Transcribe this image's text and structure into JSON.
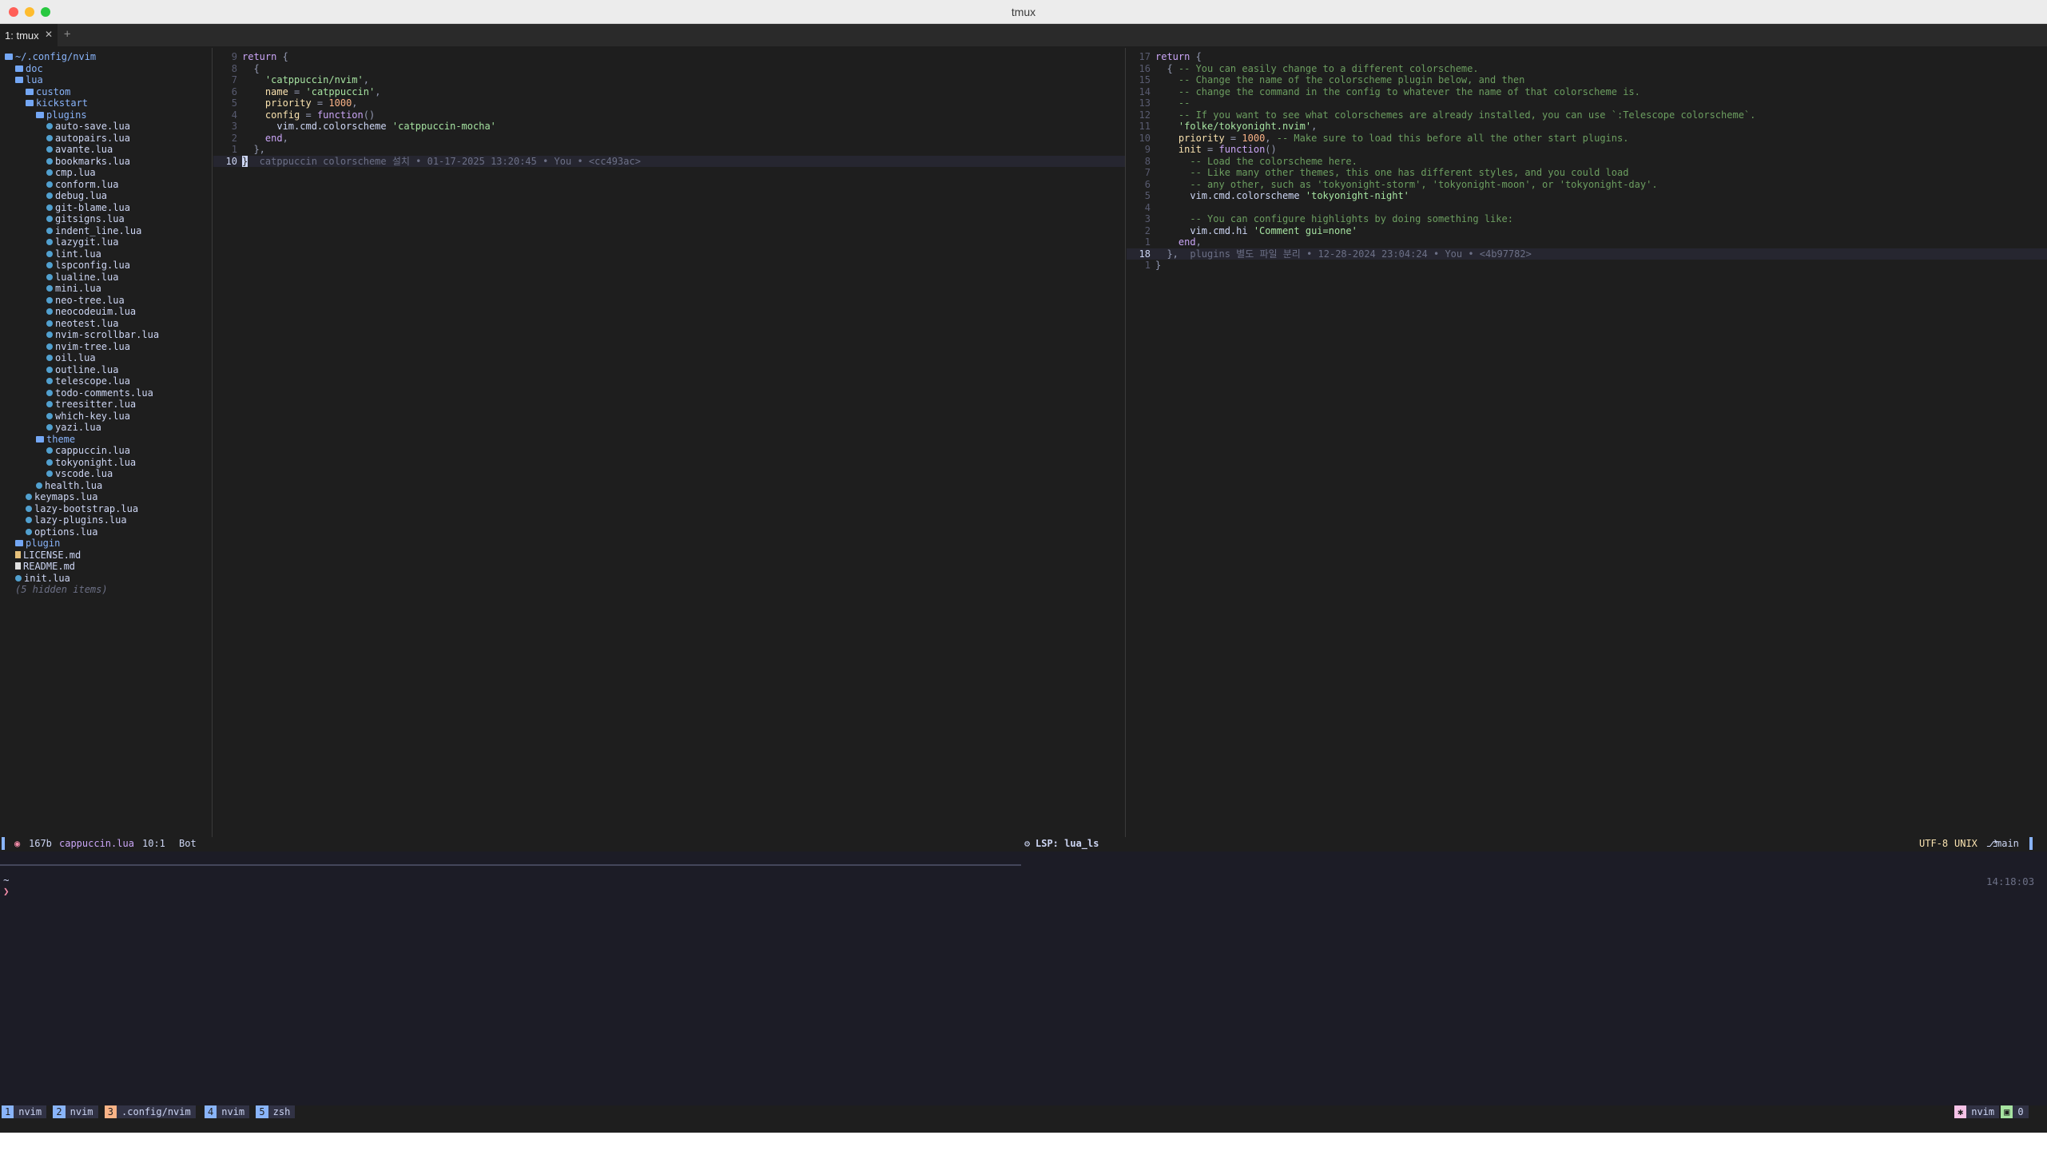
{
  "window": {
    "title": "tmux"
  },
  "tab": {
    "label": "1: tmux",
    "close": "✕",
    "new": "+"
  },
  "tree": [
    {
      "depth": 0,
      "type": "dir",
      "name": "~/.config/nvim"
    },
    {
      "depth": 1,
      "type": "dir",
      "name": "doc"
    },
    {
      "depth": 1,
      "type": "dir",
      "name": "lua"
    },
    {
      "depth": 2,
      "type": "dir",
      "name": "custom"
    },
    {
      "depth": 2,
      "type": "dir",
      "name": "kickstart"
    },
    {
      "depth": 3,
      "type": "dir",
      "name": "plugins"
    },
    {
      "depth": 4,
      "type": "lua",
      "name": "auto-save.lua"
    },
    {
      "depth": 4,
      "type": "lua",
      "name": "autopairs.lua"
    },
    {
      "depth": 4,
      "type": "lua",
      "name": "avante.lua"
    },
    {
      "depth": 4,
      "type": "lua",
      "name": "bookmarks.lua"
    },
    {
      "depth": 4,
      "type": "lua",
      "name": "cmp.lua"
    },
    {
      "depth": 4,
      "type": "lua",
      "name": "conform.lua"
    },
    {
      "depth": 4,
      "type": "lua",
      "name": "debug.lua"
    },
    {
      "depth": 4,
      "type": "lua",
      "name": "git-blame.lua"
    },
    {
      "depth": 4,
      "type": "lua",
      "name": "gitsigns.lua"
    },
    {
      "depth": 4,
      "type": "lua",
      "name": "indent_line.lua"
    },
    {
      "depth": 4,
      "type": "lua",
      "name": "lazygit.lua"
    },
    {
      "depth": 4,
      "type": "lua",
      "name": "lint.lua"
    },
    {
      "depth": 4,
      "type": "lua",
      "name": "lspconfig.lua"
    },
    {
      "depth": 4,
      "type": "lua",
      "name": "lualine.lua"
    },
    {
      "depth": 4,
      "type": "lua",
      "name": "mini.lua"
    },
    {
      "depth": 4,
      "type": "lua",
      "name": "neo-tree.lua"
    },
    {
      "depth": 4,
      "type": "lua",
      "name": "neocodeuim.lua"
    },
    {
      "depth": 4,
      "type": "lua",
      "name": "neotest.lua"
    },
    {
      "depth": 4,
      "type": "lua",
      "name": "nvim-scrollbar.lua"
    },
    {
      "depth": 4,
      "type": "lua",
      "name": "nvim-tree.lua"
    },
    {
      "depth": 4,
      "type": "lua",
      "name": "oil.lua"
    },
    {
      "depth": 4,
      "type": "lua",
      "name": "outline.lua"
    },
    {
      "depth": 4,
      "type": "lua",
      "name": "telescope.lua"
    },
    {
      "depth": 4,
      "type": "lua",
      "name": "todo-comments.lua"
    },
    {
      "depth": 4,
      "type": "lua",
      "name": "treesitter.lua"
    },
    {
      "depth": 4,
      "type": "lua",
      "name": "which-key.lua"
    },
    {
      "depth": 4,
      "type": "lua",
      "name": "yazi.lua"
    },
    {
      "depth": 3,
      "type": "dir",
      "name": "theme"
    },
    {
      "depth": 4,
      "type": "lua",
      "name": "cappuccin.lua"
    },
    {
      "depth": 4,
      "type": "lua",
      "name": "tokyonight.lua"
    },
    {
      "depth": 4,
      "type": "lua",
      "name": "vscode.lua"
    },
    {
      "depth": 3,
      "type": "lua",
      "name": "health.lua"
    },
    {
      "depth": 2,
      "type": "lua",
      "name": "keymaps.lua"
    },
    {
      "depth": 2,
      "type": "lua",
      "name": "lazy-bootstrap.lua"
    },
    {
      "depth": 2,
      "type": "lua",
      "name": "lazy-plugins.lua"
    },
    {
      "depth": 2,
      "type": "lua",
      "name": "options.lua"
    },
    {
      "depth": 1,
      "type": "dir",
      "name": "plugin"
    },
    {
      "depth": 1,
      "type": "lic",
      "name": "LICENSE.md"
    },
    {
      "depth": 1,
      "type": "md",
      "name": "README.md"
    },
    {
      "depth": 1,
      "type": "lua",
      "name": "init.lua"
    },
    {
      "depth": 1,
      "type": "hidden",
      "name": "(5 hidden items)"
    }
  ],
  "left_editor": {
    "lines": [
      {
        "n": "9",
        "indent": "",
        "tokens": [
          [
            "kw",
            "return"
          ],
          [
            "pun",
            " {"
          ]
        ]
      },
      {
        "n": "8",
        "indent": "  ",
        "tokens": [
          [
            "pun",
            "{"
          ]
        ]
      },
      {
        "n": "7",
        "indent": "    ",
        "tokens": [
          [
            "str",
            "'catppuccin/nvim'"
          ],
          [
            "pun",
            ","
          ]
        ]
      },
      {
        "n": "6",
        "indent": "    ",
        "tokens": [
          [
            "fld",
            "name"
          ],
          [
            "pun",
            " = "
          ],
          [
            "str",
            "'catppuccin'"
          ],
          [
            "pun",
            ","
          ]
        ]
      },
      {
        "n": "5",
        "indent": "    ",
        "tokens": [
          [
            "fld",
            "priority"
          ],
          [
            "pun",
            " = "
          ],
          [
            "num",
            "1000"
          ],
          [
            "pun",
            ","
          ]
        ]
      },
      {
        "n": "4",
        "indent": "    ",
        "tokens": [
          [
            "fld",
            "config"
          ],
          [
            "pun",
            " = "
          ],
          [
            "kw",
            "function"
          ],
          [
            "pun",
            "()"
          ]
        ]
      },
      {
        "n": "3",
        "indent": "      ",
        "tokens": [
          [
            "id",
            "vim.cmd.colorscheme"
          ],
          [
            "str",
            " 'catppuccin-mocha'"
          ]
        ]
      },
      {
        "n": "2",
        "indent": "    ",
        "tokens": [
          [
            "kw",
            "end"
          ],
          [
            "pun",
            ","
          ]
        ]
      },
      {
        "n": "1",
        "indent": "  ",
        "tokens": [
          [
            "pun",
            "},"
          ]
        ]
      },
      {
        "n": "10",
        "indent": "",
        "cur": true,
        "cursor": "}",
        "tokens": [
          [
            "blame",
            "  catppuccin colorscheme 설치 • 01-17-2025 13:20:45 • You • <cc493ac>"
          ]
        ]
      }
    ]
  },
  "right_editor": {
    "lines": [
      {
        "n": "17",
        "indent": "",
        "tokens": [
          [
            "kw",
            "return"
          ],
          [
            "pun",
            " {"
          ]
        ]
      },
      {
        "n": "16",
        "indent": "  ",
        "tokens": [
          [
            "pun",
            "{ "
          ],
          [
            "cm",
            "-- You can easily change to a different colorscheme."
          ]
        ]
      },
      {
        "n": "15",
        "indent": "    ",
        "tokens": [
          [
            "cm",
            "-- Change the name of the colorscheme plugin below, and then"
          ]
        ]
      },
      {
        "n": "14",
        "indent": "    ",
        "tokens": [
          [
            "cm",
            "-- change the command in the config to whatever the name of that colorscheme is."
          ]
        ]
      },
      {
        "n": "13",
        "indent": "    ",
        "tokens": [
          [
            "cm",
            "--"
          ]
        ]
      },
      {
        "n": "12",
        "indent": "    ",
        "tokens": [
          [
            "cm",
            "-- If you want to see what colorschemes are already installed, you can use `:Telescope colorscheme`."
          ]
        ]
      },
      {
        "n": "11",
        "indent": "    ",
        "tokens": [
          [
            "str",
            "'folke/tokyonight.nvim'"
          ],
          [
            "pun",
            ","
          ]
        ]
      },
      {
        "n": "10",
        "indent": "    ",
        "tokens": [
          [
            "fld",
            "priority"
          ],
          [
            "pun",
            " = "
          ],
          [
            "num",
            "1000"
          ],
          [
            "pun",
            ", "
          ],
          [
            "cm",
            "-- Make sure to load this before all the other start plugins."
          ]
        ]
      },
      {
        "n": "9",
        "indent": "    ",
        "tokens": [
          [
            "fld",
            "init"
          ],
          [
            "pun",
            " = "
          ],
          [
            "kw",
            "function"
          ],
          [
            "pun",
            "()"
          ]
        ]
      },
      {
        "n": "8",
        "indent": "      ",
        "tokens": [
          [
            "cm",
            "-- Load the colorscheme here."
          ]
        ]
      },
      {
        "n": "7",
        "indent": "      ",
        "tokens": [
          [
            "cm",
            "-- Like many other themes, this one has different styles, and you could load"
          ]
        ]
      },
      {
        "n": "6",
        "indent": "      ",
        "tokens": [
          [
            "cm",
            "-- any other, such as 'tokyonight-storm', 'tokyonight-moon', or 'tokyonight-day'."
          ]
        ]
      },
      {
        "n": "5",
        "indent": "      ",
        "tokens": [
          [
            "id",
            "vim.cmd.colorscheme"
          ],
          [
            "str",
            " 'tokyonight-night'"
          ]
        ]
      },
      {
        "n": "4",
        "indent": "",
        "tokens": []
      },
      {
        "n": "3",
        "indent": "      ",
        "tokens": [
          [
            "cm",
            "-- You can configure highlights by doing something like:"
          ]
        ]
      },
      {
        "n": "2",
        "indent": "      ",
        "tokens": [
          [
            "id",
            "vim.cmd.hi"
          ],
          [
            "str",
            " 'Comment gui=none'"
          ]
        ]
      },
      {
        "n": "1",
        "indent": "    ",
        "tokens": [
          [
            "kw",
            "end"
          ],
          [
            "pun",
            ","
          ]
        ]
      },
      {
        "n": "18",
        "indent": "  ",
        "cur": true,
        "tokens": [
          [
            "pun",
            "},"
          ],
          [
            "blame",
            "  plugins 별도 파일 분리 • 12-28-2024 23:04:24 • You • <4b97782>"
          ]
        ]
      },
      {
        "n": "1",
        "indent": "",
        "tokens": [
          [
            "pun",
            "}"
          ]
        ]
      }
    ]
  },
  "statusline": {
    "size": "167b",
    "filename": "cappuccin.lua",
    "position": "10:1",
    "scroll": "Bot",
    "lsp": "LSP: lua_ls",
    "encoding": "UTF-8",
    "format": "UNIX",
    "branch": "main"
  },
  "terminal": {
    "cwd": "~",
    "prompt": "❯",
    "time": "14:18:03"
  },
  "tmux": {
    "windows": [
      {
        "num": "1",
        "name": "nvim",
        "color": "#89b4fa"
      },
      {
        "num": "2",
        "name": "nvim",
        "color": "#89b4fa"
      },
      {
        "num": "3",
        "name": ".config/nvim",
        "color": "#fab387"
      },
      {
        "num": "4",
        "name": "nvim",
        "color": "#89b4fa"
      },
      {
        "num": "5",
        "name": "zsh",
        "color": "#89b4fa"
      }
    ],
    "right": {
      "session": "nvim",
      "count": "0"
    }
  }
}
